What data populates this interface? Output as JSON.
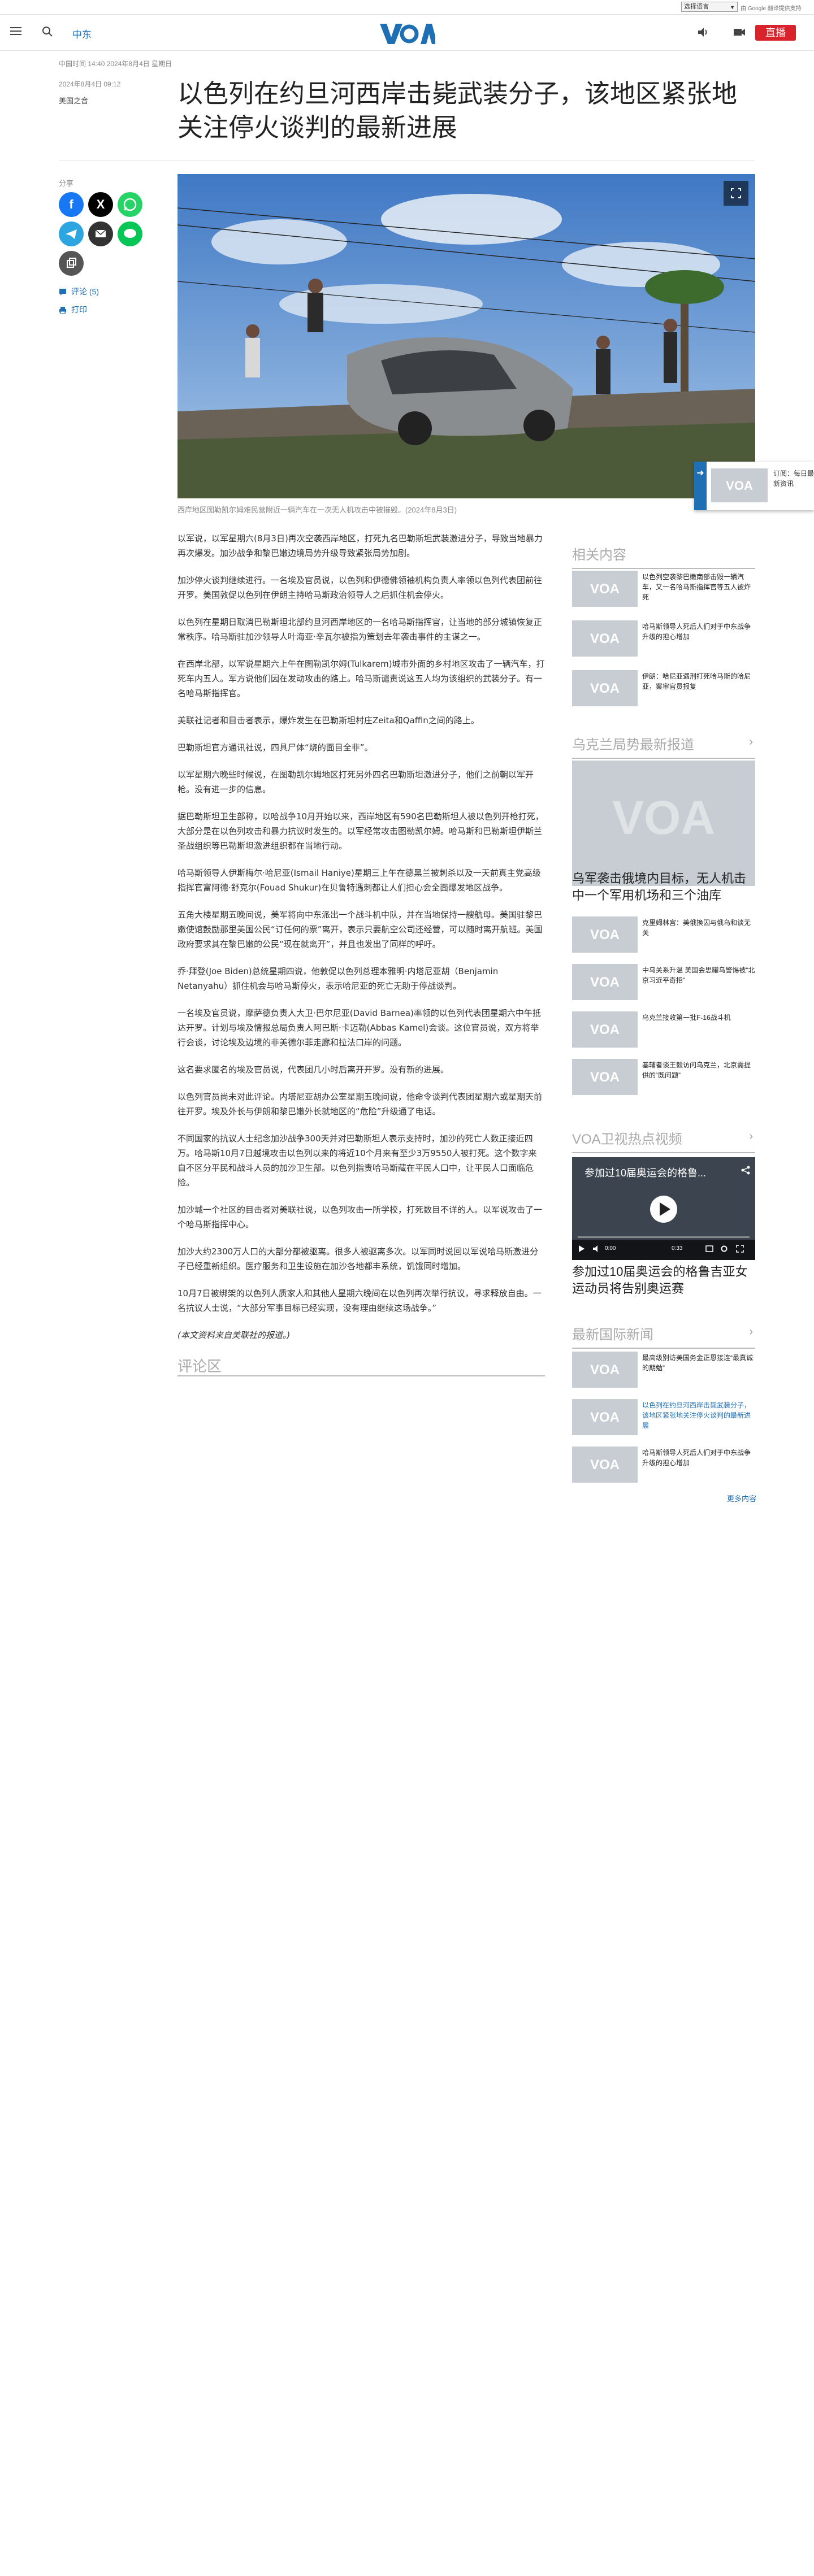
{
  "lang_bar": {
    "select_label": "选择语言",
    "powered_by": "由 Google 翻译提供支持"
  },
  "header": {
    "nav_label": "中东",
    "live_label": "直播"
  },
  "article": {
    "dateline": "中国时间 14:40 2024年8月4日 星期日",
    "pub_date": "2024年8月4日 09:12",
    "section": "美国之音",
    "title": "以色列在约旦河西岸击毙武装分子，该地区紧张地关注停火谈判的最新进展",
    "caption": "西岸地区图勒凯尔姆难民营附近一辆汽车在一次无人机攻击中被摧毁。(2024年8月3日)",
    "paragraphs": [
      "以军说，以军星期六(8月3日)再次空袭西岸地区，打死九名巴勒斯坦武装激进分子，导致当地暴力再次爆发。加沙战争和黎巴嫩边境局势升级导致紧张局势加剧。",
      "加沙停火谈判继续进行。一名埃及官员说，以色列和伊德佛领袖机构负责人率领以色列代表团前往开罗。美国敦促以色列在伊朗主持哈马斯政治领导人之后抓住机会停火。",
      "以色列在星期日取消巴勒斯坦北部约旦河西岸地区的一名哈马斯指挥官，让当地的部分城镇恢复正常秩序。哈马斯驻加沙领导人叶海亚·辛瓦尔被指为策划去年袭击事件的主谋之一。",
      "在西岸北部，以军说星期六上午在图勒凯尔姆(Tulkarem)城市外面的乡村地区攻击了一辆汽车，打死车内五人。军方说他们因在发动攻击的路上。哈马斯谴责说这五人均为该组织的武装分子。有一名哈马斯指挥官。",
      "美联社记者和目击者表示，爆炸发生在巴勒斯坦村庄Zeita和Qaffin之间的路上。",
      "巴勒斯坦官方通讯社说，四具尸体“烧的面目全非”。",
      "以军星期六晚些时候说，在图勒凯尔姆地区打死另外四名巴勒斯坦激进分子，他们之前朝以军开枪。没有进一步的信息。",
      "据巴勒斯坦卫生部称，以哈战争10月开始以来，西岸地区有590名巴勒斯坦人被以色列开枪打死，大部分是在以色列攻击和暴力抗议时发生的。以军经常攻击图勒凯尔姆。哈马斯和巴勒斯坦伊斯兰圣战组织等巴勒斯坦激进组织都在当地行动。",
      "哈马斯领导人伊斯梅尔·哈尼亚(Ismail Haniye)星期三上午在德黑兰被刺杀以及一天前真主党高级指挥官富阿德·舒克尔(Fouad Shukur)在贝鲁特遇刺都让人们担心会全面爆发地区战争。",
      "五角大楼星期五晚间说，美军将向中东派出一个战斗机中队，并在当地保持一艘航母。美国驻黎巴嫩使馆鼓励那里美国公民“订任何的票”离开，表示只要航空公司还经营，可以随时离开航班。美国政府要求其在黎巴嫩的公民“现在就离开”，并且也发出了同样的呼吁。",
      "乔·拜登(Joe Biden)总统星期四说，他敦促以色列总理本雅明·内塔尼亚胡（Benjamin Netanyahu）抓住机会与哈马斯停火，表示哈尼亚的死亡无助于停战谈判。",
      "一名埃及官员说，摩萨德负责人大卫·巴尔尼亚(David Barnea)率领的以色列代表团星期六中午抵达开罗。计划与埃及情报总局负责人阿巴斯·卡迈勒(Abbas Kamel)会谈。这位官员说，双方将举行会谈，讨论埃及边境的非美德尔菲走廊和拉法口岸的问题。",
      "这名要求匿名的埃及官员说，代表团几小时后离开开罗。没有新的进展。",
      "以色列官员尚未对此评论。内塔尼亚胡办公室星期五晚间说，他命令谈判代表团星期六或星期天前往开罗。埃及外长与伊朗和黎巴嫩外长就地区的“危险”升级通了电话。",
      "不同国家的抗议人士纪念加沙战争300天并对巴勒斯坦人表示支持时，加沙的死亡人数正接近四万。哈马斯10月7日越境攻击以色列以来的将近10个月来有至少3万9550人被打死。这个数字来自不区分平民和战斗人员的加沙卫生部。以色列指责哈马斯藏在平民人口中，让平民人口面临危险。",
      "加沙城一个社区的目击者对美联社说，以色列攻击一所学校，打死数目不详的人。以军说攻击了一个哈马斯指挥中心。",
      "加沙大约2300万人口的大部分都被驱离。很多人被驱离多次。以军同时说回以军说哈马斯激进分子已经重新组织。医疗服务和卫生设施在加沙各地都丰系统，饥饿同时增加。",
      "10月7日被绑架的以色列人质家人和其他人星期六晚间在以色列再次举行抗议，寻求释放自由。一名抗议人士说，“大部分军事目标已经实现，没有理由继续这场战争。”"
    ],
    "note": "(本文资料来自美联社的报道。)",
    "comments_title": "评论区"
  },
  "share": {
    "label": "分享",
    "comments_link": "评论 (5)",
    "print_link": "打印"
  },
  "subscribe_widget": {
    "text": "订阅：每日最新资讯"
  },
  "sidebar": {
    "related": {
      "title": "相关内容",
      "items": [
        "以色列空袭黎巴嫩南部击毁一辆汽车，又一名哈马斯指挥官等五人被炸死",
        "哈马斯领导人死后人们对于中东战争升级的担心增加",
        "伊朗：哈尼亚遇刑打死哈马斯的哈尼亚，案审官员报复"
      ]
    },
    "ukraine": {
      "title": "乌克兰局势最新报道",
      "feature": "乌军袭击俄境内目标，无人机击中一个军用机场和三个油库",
      "items": [
        "克里姆林宫：美俄换囚与俄乌和谈无关",
        "中乌关系升温 美国会思罐乌警惕被“北京习近平奇招”",
        "乌克兰接收第一批F-16战斗机",
        "基辅者谈王毅访问乌克兰，北京需提供的“既问题”"
      ]
    },
    "video": {
      "title": "VOA卫视热点视频",
      "player_title": "参加过10届奥运会的格鲁...",
      "current_time": "0:00",
      "duration": "0:33",
      "caption": "参加过10届奥运会的格鲁吉亚女运动员将告别奥运赛"
    },
    "international": {
      "title": "最新国际新闻",
      "items": [
        "最高级别访美国务金正恩接连“最真诚的期勉”",
        "以色列在约旦河西岸击毙武装分子，该地区紧张地关注停火谈判的最新进展",
        "哈马斯领导人死后人们对于中东战争升级的担心增加"
      ],
      "more": "更多内容"
    }
  },
  "colors": {
    "brand_blue": "#1f6fb5",
    "live_red": "#d8232a",
    "facebook": "#1877f2",
    "x": "#000000",
    "whatsapp": "#25d366",
    "telegram": "#2ca5e0",
    "email": "#333333",
    "line": "#06c755",
    "copy": "#555555"
  }
}
